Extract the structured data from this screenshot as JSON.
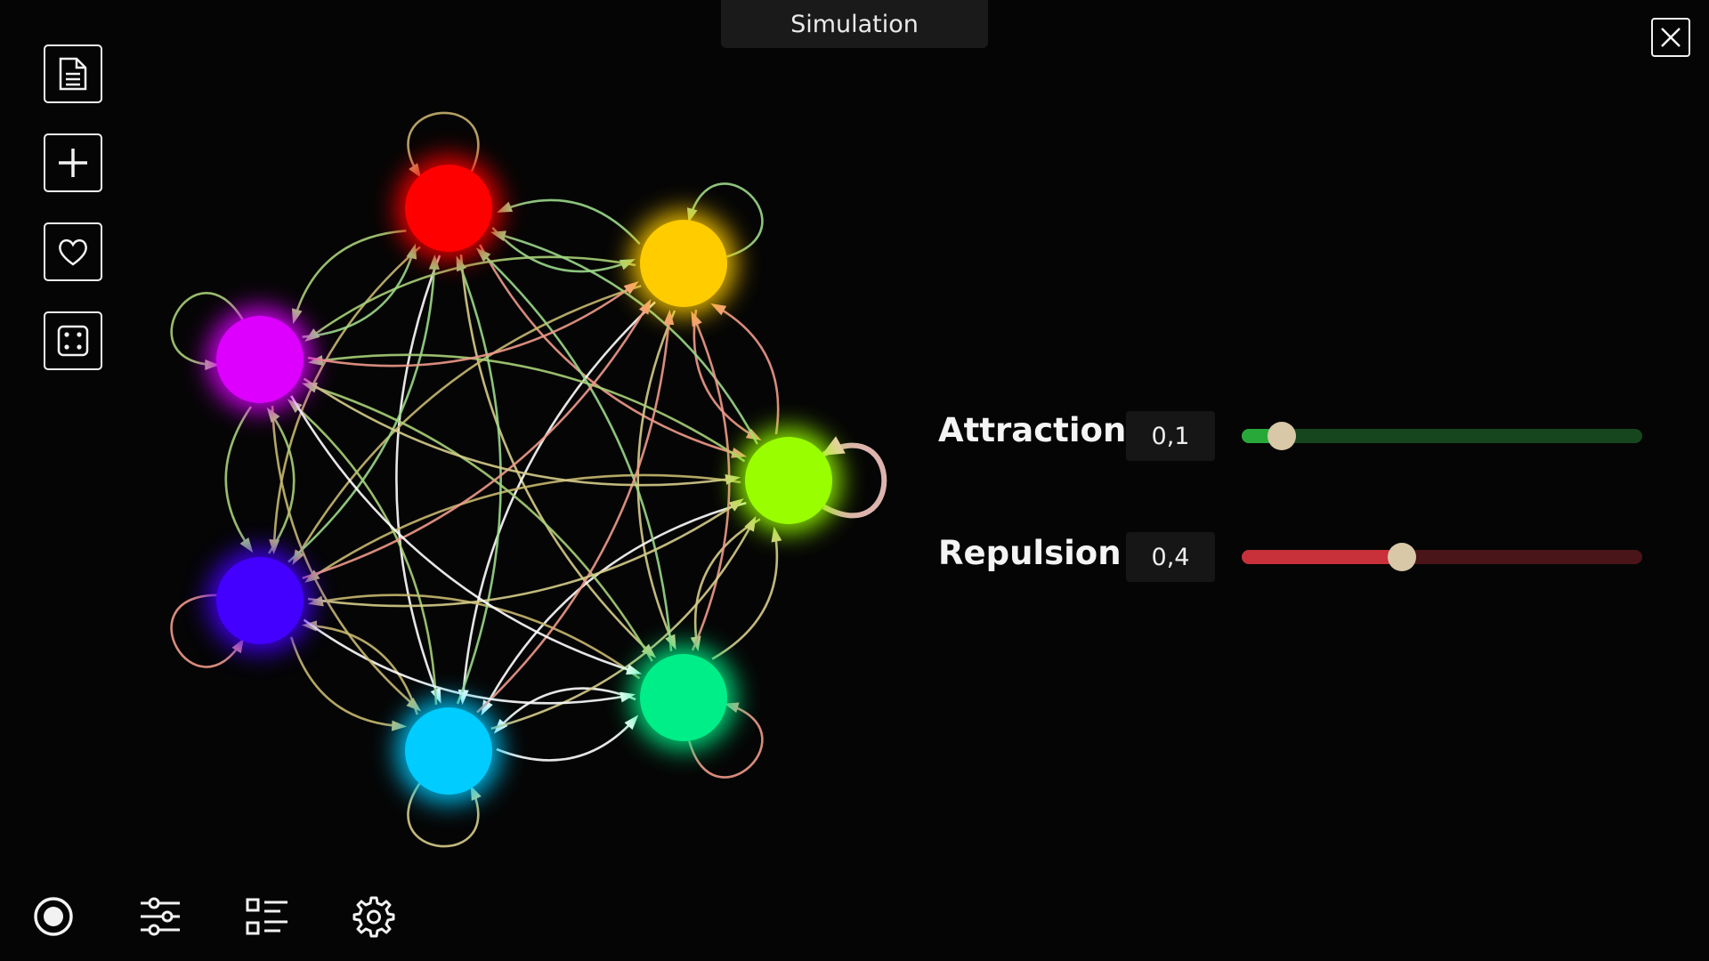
{
  "window": {
    "title": "Simulation"
  },
  "sidebar": {
    "items": [
      {
        "name": "document-icon"
      },
      {
        "name": "plus-icon"
      },
      {
        "name": "heart-icon"
      },
      {
        "name": "dice-icon"
      }
    ]
  },
  "bottom_bar": {
    "items": [
      {
        "name": "record-icon"
      },
      {
        "name": "sliders-icon"
      },
      {
        "name": "list-icon"
      },
      {
        "name": "gear-icon"
      }
    ]
  },
  "graph": {
    "nodes": [
      {
        "id": "red",
        "color": "#ff0000"
      },
      {
        "id": "yellow",
        "color": "#ffcc00"
      },
      {
        "id": "lime",
        "color": "#99ff00"
      },
      {
        "id": "teal",
        "color": "#00ee88"
      },
      {
        "id": "cyan",
        "color": "#00ccff"
      },
      {
        "id": "blue",
        "color": "#4400ff"
      },
      {
        "id": "magenta",
        "color": "#dd00ff"
      }
    ],
    "edge_colors": [
      "#9bd88a",
      "#f09a8a",
      "#d6cc8a",
      "#ffffff",
      "#c8b870",
      "#a8d078"
    ]
  },
  "params": {
    "attraction": {
      "label": "Attraction",
      "value": "0,1",
      "level": 0.1,
      "color": "#29a83a",
      "track": "#16461e"
    },
    "repulsion": {
      "label": "Repulsion",
      "value": "0,4",
      "level": 0.4,
      "color": "#c8303a",
      "track": "#4a1518"
    }
  }
}
